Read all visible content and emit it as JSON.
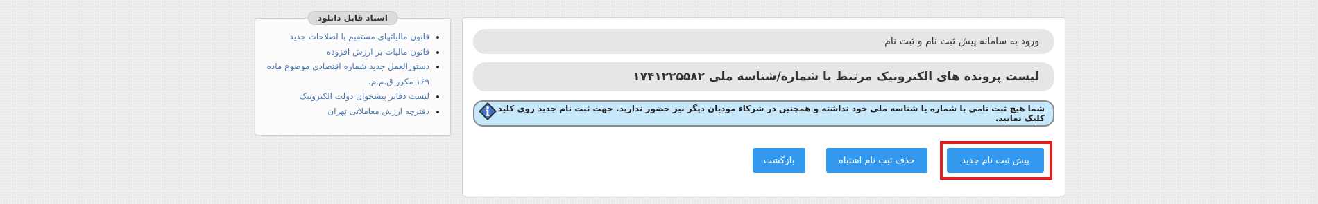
{
  "docs": {
    "title": "اسناد قابل دانلود",
    "items": [
      "قانون مالیاتهای مستقیم با اصلاحات جدید",
      "قانون مالیات بر ارزش افزوده",
      "دستورالعمل جدید شماره اقتصادی موضوع ماده ۱۶۹ مکرر ق.م.م.",
      "لیست دفاتر پیشخوان دولت الکترونیک",
      "دفترچه ارزش معاملاتی تهران"
    ]
  },
  "main": {
    "login_title": "ورود به سامانه پیش ثبت نام و ثبت نام",
    "list_title": "لیست پرونده های الکترونیک مرتبط با شماره/شناسه ملی ۱۷۴۱۲۲۵۵۸۲",
    "info_message": "شما هیچ ثبت نامی با شماره یا شناسه ملی خود نداشته و همچنین در شرکاء مودیان دیگر نیز حضور ندارید. جهت ثبت نام جدید روی کلید زیر کلیک نمایید.",
    "buttons": {
      "new_registration": "پیش ثبت نام جدید",
      "delete_wrong": "حذف ثبت نام اشتباه",
      "back": "بازگشت"
    }
  },
  "colors": {
    "button": "#3399ee",
    "info_background": "#c7e7fb",
    "highlight": "#e02020",
    "link": "#4a78b0"
  },
  "icons": {
    "info": "info-icon"
  }
}
